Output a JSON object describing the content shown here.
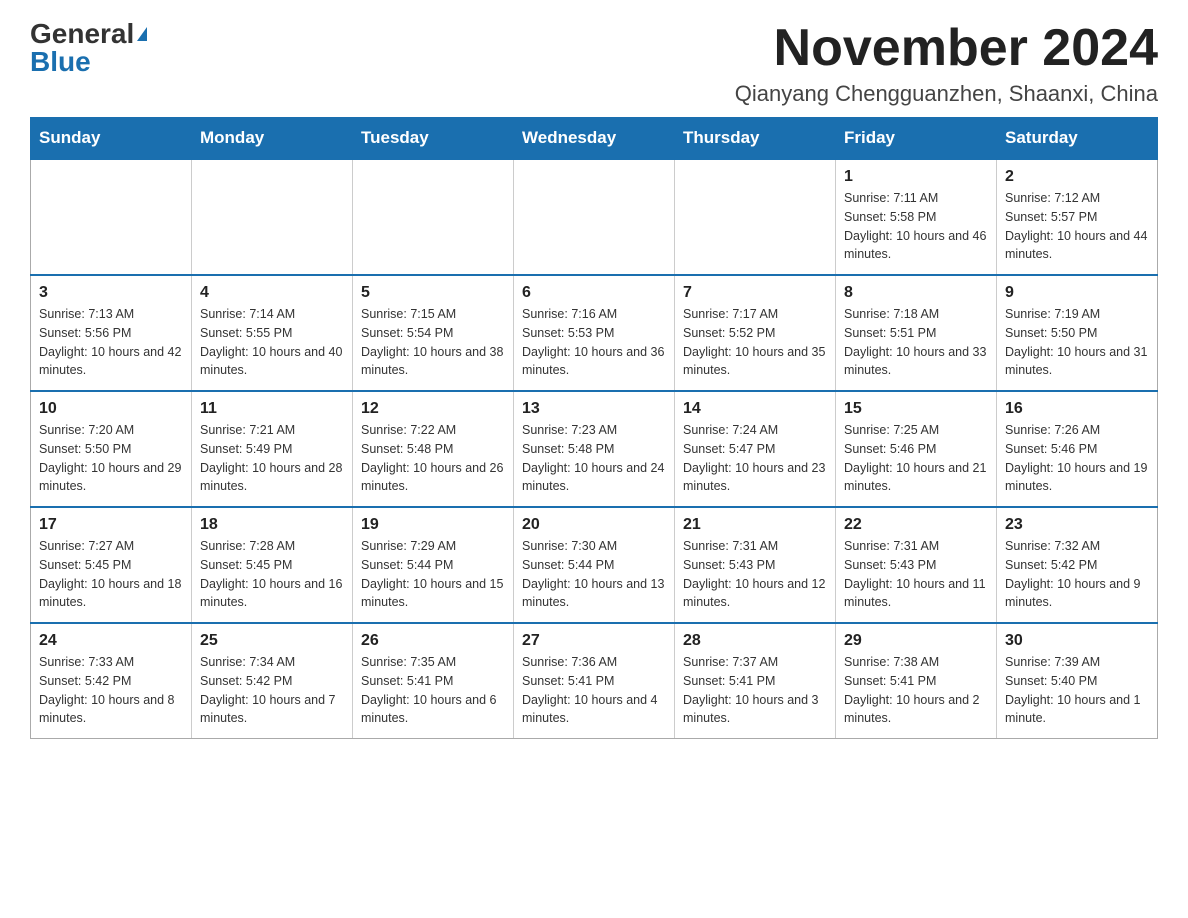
{
  "logo": {
    "general": "General",
    "blue": "Blue"
  },
  "header": {
    "month_year": "November 2024",
    "location": "Qianyang Chengguanzhen, Shaanxi, China"
  },
  "days_of_week": [
    "Sunday",
    "Monday",
    "Tuesday",
    "Wednesday",
    "Thursday",
    "Friday",
    "Saturday"
  ],
  "weeks": [
    [
      {
        "day": "",
        "info": ""
      },
      {
        "day": "",
        "info": ""
      },
      {
        "day": "",
        "info": ""
      },
      {
        "day": "",
        "info": ""
      },
      {
        "day": "",
        "info": ""
      },
      {
        "day": "1",
        "info": "Sunrise: 7:11 AM\nSunset: 5:58 PM\nDaylight: 10 hours and 46 minutes."
      },
      {
        "day": "2",
        "info": "Sunrise: 7:12 AM\nSunset: 5:57 PM\nDaylight: 10 hours and 44 minutes."
      }
    ],
    [
      {
        "day": "3",
        "info": "Sunrise: 7:13 AM\nSunset: 5:56 PM\nDaylight: 10 hours and 42 minutes."
      },
      {
        "day": "4",
        "info": "Sunrise: 7:14 AM\nSunset: 5:55 PM\nDaylight: 10 hours and 40 minutes."
      },
      {
        "day": "5",
        "info": "Sunrise: 7:15 AM\nSunset: 5:54 PM\nDaylight: 10 hours and 38 minutes."
      },
      {
        "day": "6",
        "info": "Sunrise: 7:16 AM\nSunset: 5:53 PM\nDaylight: 10 hours and 36 minutes."
      },
      {
        "day": "7",
        "info": "Sunrise: 7:17 AM\nSunset: 5:52 PM\nDaylight: 10 hours and 35 minutes."
      },
      {
        "day": "8",
        "info": "Sunrise: 7:18 AM\nSunset: 5:51 PM\nDaylight: 10 hours and 33 minutes."
      },
      {
        "day": "9",
        "info": "Sunrise: 7:19 AM\nSunset: 5:50 PM\nDaylight: 10 hours and 31 minutes."
      }
    ],
    [
      {
        "day": "10",
        "info": "Sunrise: 7:20 AM\nSunset: 5:50 PM\nDaylight: 10 hours and 29 minutes."
      },
      {
        "day": "11",
        "info": "Sunrise: 7:21 AM\nSunset: 5:49 PM\nDaylight: 10 hours and 28 minutes."
      },
      {
        "day": "12",
        "info": "Sunrise: 7:22 AM\nSunset: 5:48 PM\nDaylight: 10 hours and 26 minutes."
      },
      {
        "day": "13",
        "info": "Sunrise: 7:23 AM\nSunset: 5:48 PM\nDaylight: 10 hours and 24 minutes."
      },
      {
        "day": "14",
        "info": "Sunrise: 7:24 AM\nSunset: 5:47 PM\nDaylight: 10 hours and 23 minutes."
      },
      {
        "day": "15",
        "info": "Sunrise: 7:25 AM\nSunset: 5:46 PM\nDaylight: 10 hours and 21 minutes."
      },
      {
        "day": "16",
        "info": "Sunrise: 7:26 AM\nSunset: 5:46 PM\nDaylight: 10 hours and 19 minutes."
      }
    ],
    [
      {
        "day": "17",
        "info": "Sunrise: 7:27 AM\nSunset: 5:45 PM\nDaylight: 10 hours and 18 minutes."
      },
      {
        "day": "18",
        "info": "Sunrise: 7:28 AM\nSunset: 5:45 PM\nDaylight: 10 hours and 16 minutes."
      },
      {
        "day": "19",
        "info": "Sunrise: 7:29 AM\nSunset: 5:44 PM\nDaylight: 10 hours and 15 minutes."
      },
      {
        "day": "20",
        "info": "Sunrise: 7:30 AM\nSunset: 5:44 PM\nDaylight: 10 hours and 13 minutes."
      },
      {
        "day": "21",
        "info": "Sunrise: 7:31 AM\nSunset: 5:43 PM\nDaylight: 10 hours and 12 minutes."
      },
      {
        "day": "22",
        "info": "Sunrise: 7:31 AM\nSunset: 5:43 PM\nDaylight: 10 hours and 11 minutes."
      },
      {
        "day": "23",
        "info": "Sunrise: 7:32 AM\nSunset: 5:42 PM\nDaylight: 10 hours and 9 minutes."
      }
    ],
    [
      {
        "day": "24",
        "info": "Sunrise: 7:33 AM\nSunset: 5:42 PM\nDaylight: 10 hours and 8 minutes."
      },
      {
        "day": "25",
        "info": "Sunrise: 7:34 AM\nSunset: 5:42 PM\nDaylight: 10 hours and 7 minutes."
      },
      {
        "day": "26",
        "info": "Sunrise: 7:35 AM\nSunset: 5:41 PM\nDaylight: 10 hours and 6 minutes."
      },
      {
        "day": "27",
        "info": "Sunrise: 7:36 AM\nSunset: 5:41 PM\nDaylight: 10 hours and 4 minutes."
      },
      {
        "day": "28",
        "info": "Sunrise: 7:37 AM\nSunset: 5:41 PM\nDaylight: 10 hours and 3 minutes."
      },
      {
        "day": "29",
        "info": "Sunrise: 7:38 AM\nSunset: 5:41 PM\nDaylight: 10 hours and 2 minutes."
      },
      {
        "day": "30",
        "info": "Sunrise: 7:39 AM\nSunset: 5:40 PM\nDaylight: 10 hours and 1 minute."
      }
    ]
  ]
}
